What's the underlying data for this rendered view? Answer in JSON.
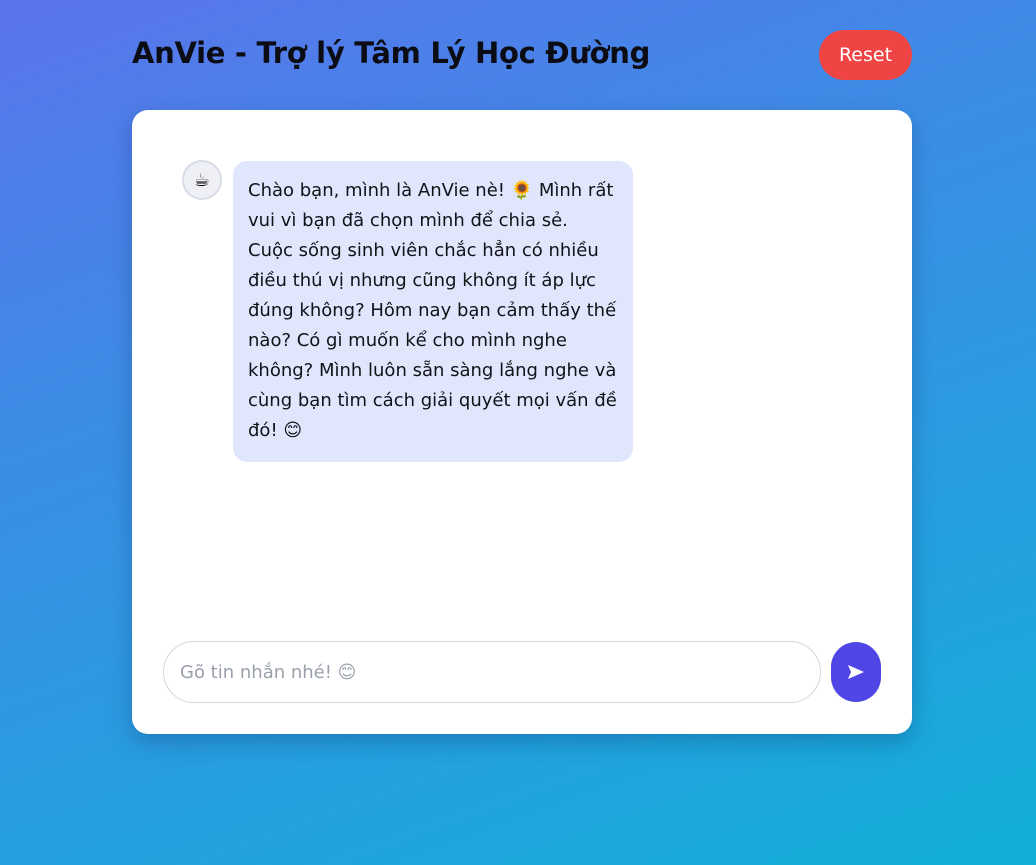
{
  "header": {
    "title": "AnVie - Trợ lý Tâm Lý Học Đường",
    "reset_label": "Reset"
  },
  "chat": {
    "messages": [
      {
        "sender": "bot",
        "avatar_icon": "bot-avatar-icon",
        "avatar_glyph": "☕",
        "text": "Chào bạn, mình là AnVie nè! 🌻 Mình rất vui vì bạn đã chọn mình để chia sẻ. Cuộc sống sinh viên chắc hẳn có nhiều điều thú vị nhưng cũng không ít áp lực đúng không? Hôm nay bạn cảm thấy thế nào? Có gì muốn kể cho mình nghe không? Mình luôn sẵn sàng lắng nghe và cùng bạn tìm cách giải quyết mọi vấn đề đó! 😊"
      }
    ]
  },
  "composer": {
    "value": "",
    "placeholder": "Gõ tin nhắn nhé! 😊",
    "send_icon": "send-icon"
  },
  "colors": {
    "accent": "#4f46e5",
    "reset": "#ef4444",
    "bot_bubble": "#e0e6fc"
  }
}
